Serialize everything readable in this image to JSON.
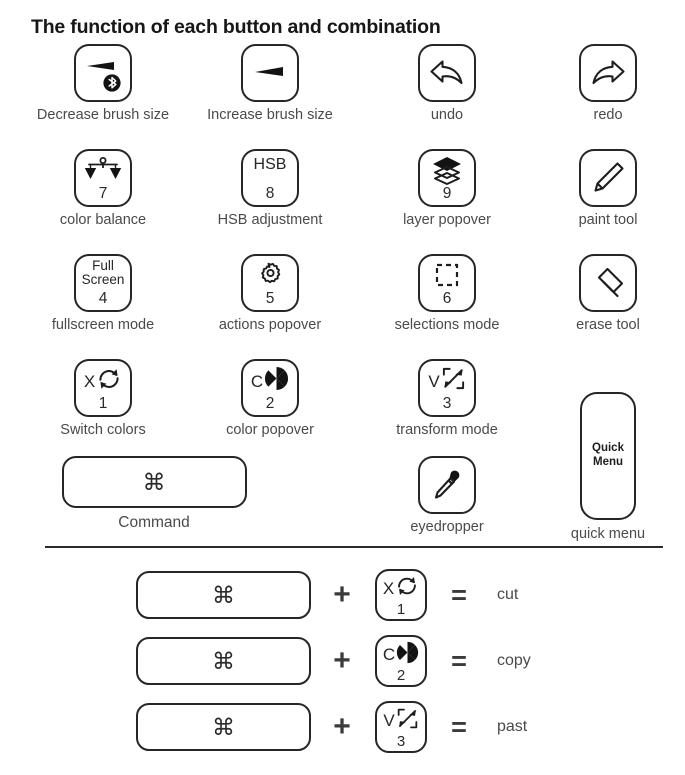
{
  "title": "The function of each button and combination",
  "keys": [
    [
      {
        "icon": "brush-decrease-icon",
        "label": "Decrease brush size",
        "name": "key-decrease-brush-size"
      },
      {
        "icon": "brush-increase-icon",
        "label": "Increase brush size",
        "name": "key-increase-brush-size"
      },
      {
        "icon": "undo-arrow-icon",
        "label": "undo",
        "name": "key-undo"
      },
      {
        "icon": "redo-arrow-icon",
        "label": "redo",
        "name": "key-redo"
      }
    ],
    [
      {
        "icon": "balance-scales-icon",
        "number": "7",
        "label": "color balance",
        "name": "key-color-balance"
      },
      {
        "text": "HSB",
        "number": "8",
        "label": "HSB adjustment",
        "name": "key-hsb-adjustment"
      },
      {
        "icon": "layers-icon",
        "number": "9",
        "label": "layer popover",
        "name": "key-layer-popover"
      },
      {
        "icon": "pencil-icon",
        "label": "paint tool",
        "name": "key-paint-tool"
      }
    ],
    [
      {
        "text": "Full\nScreen",
        "number": "4",
        "label": "fullscreen mode",
        "name": "key-fullscreen-mode"
      },
      {
        "icon": "gear-icon",
        "number": "5",
        "label": "actions popover",
        "name": "key-actions-popover"
      },
      {
        "icon": "marquee-selection-icon",
        "number": "6",
        "label": "selections mode",
        "name": "key-selections-mode"
      },
      {
        "icon": "eraser-icon",
        "label": "erase tool",
        "name": "key-erase-tool"
      }
    ],
    [
      {
        "letter": "X",
        "icon": "swap-arrows-icon",
        "number": "1",
        "label": "Switch colors",
        "name": "key-switch-colors"
      },
      {
        "letter": "C",
        "icon": "color-wheel-icon",
        "number": "2",
        "label": "color popover",
        "name": "key-color-popover"
      },
      {
        "letter": "V",
        "icon": "transform-expand-icon",
        "number": "3",
        "label": "transform mode",
        "name": "key-transform-mode"
      }
    ]
  ],
  "quick_menu": {
    "key_text_line1": "Quick",
    "key_text_line2": "Menu",
    "label": "quick menu"
  },
  "command": {
    "glyph": "⌘",
    "label": "Command"
  },
  "eyedropper": {
    "icon": "eyedropper-icon",
    "label": "eyedropper"
  },
  "combinations": {
    "plus_sign": "+",
    "equals_sign": "=",
    "rows": [
      {
        "modifier_glyph": "⌘",
        "letter": "X",
        "icon": "swap-arrows-icon",
        "number": "1",
        "result": "cut",
        "name": "combo-cut"
      },
      {
        "modifier_glyph": "⌘",
        "letter": "C",
        "icon": "color-wheel-icon",
        "number": "2",
        "result": "copy",
        "name": "combo-copy"
      },
      {
        "modifier_glyph": "⌘",
        "letter": "V",
        "icon": "transform-expand-icon",
        "number": "3",
        "result": "past",
        "name": "combo-paste"
      }
    ]
  },
  "colors": {
    "ink": "#262626",
    "text": "#4a4a4a",
    "background": "#ffffff"
  }
}
